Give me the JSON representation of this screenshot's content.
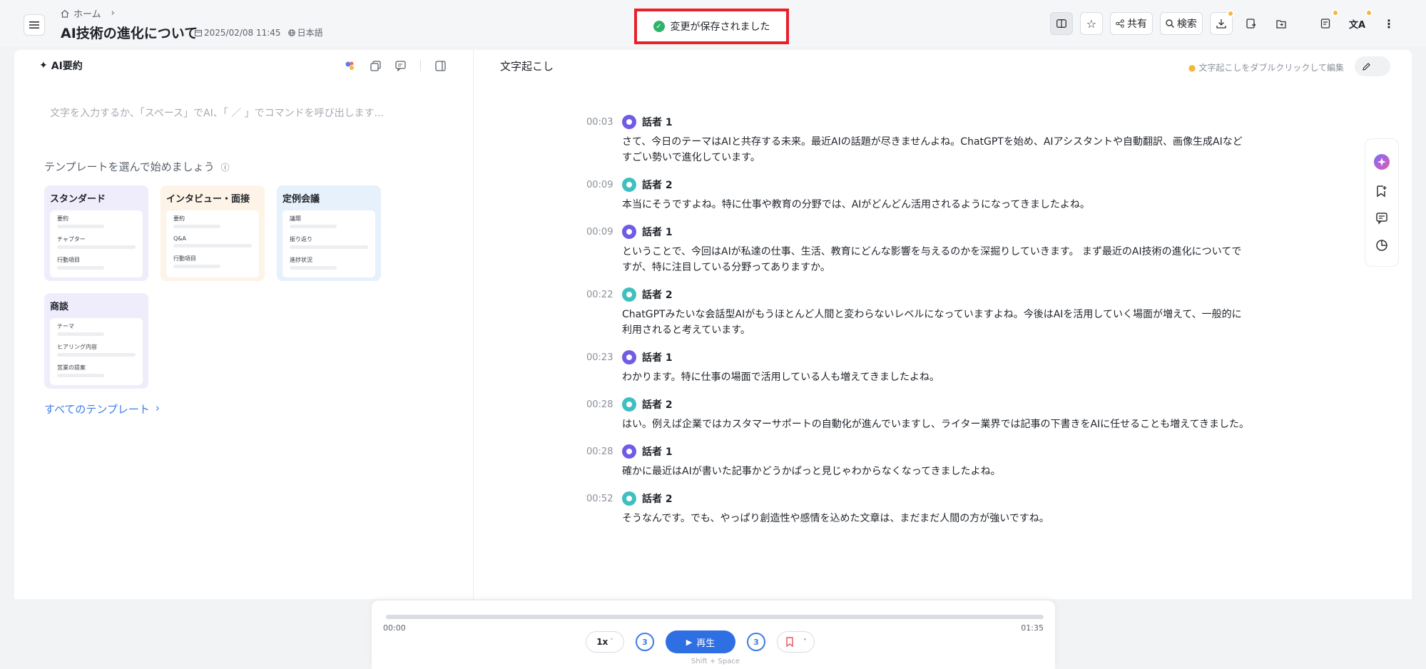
{
  "header": {
    "breadcrumb_home": "ホーム",
    "title": "AI技術の進化について",
    "date": "2025/02/08 11:45",
    "language": "日本語",
    "toast": "変更が保存されました",
    "share_label": "共有",
    "search_label": "検索"
  },
  "summary": {
    "title": "AI要約",
    "input_placeholder": "文字を入力するか、「スペース」でAI、「 ／ 」でコマンドを呼び出します...",
    "template_heading": "テンプレートを選んで始めましょう",
    "templates": [
      {
        "title": "スタンダード",
        "rows": [
          "要約",
          "チャプター",
          "行動項目"
        ],
        "color": "#efedfb"
      },
      {
        "title": "インタビュー・面接",
        "rows": [
          "要約",
          "Q&A",
          "行動項目"
        ],
        "color": "#fdf3e6"
      },
      {
        "title": "定例会議",
        "rows": [
          "議題",
          "振り返り",
          "進捗状況"
        ],
        "color": "#e7f1fb"
      },
      {
        "title": "商談",
        "rows": [
          "テーマ",
          "ヒアリング内容",
          "営業の提案"
        ],
        "color": "#efedfb"
      }
    ],
    "all_templates": "すべてのテンプレート"
  },
  "transcript": {
    "title": "文字起こし",
    "hint": "文字起こしをダブルクリックして編集",
    "segments": [
      {
        "time": "00:03",
        "speaker": "話者 1",
        "sp": "sp1",
        "text": "さて、今日のテーマはAIと共存する未来。最近AIの話題が尽きませんよね。ChatGPTを始め、AIアシスタントや自動翻訳、画像生成AIなどすごい勢いで進化しています。"
      },
      {
        "time": "00:09",
        "speaker": "話者 2",
        "sp": "sp2",
        "text": "本当にそうですよね。特に仕事や教育の分野では、AIがどんどん活用されるようになってきましたよね。"
      },
      {
        "time": "00:09",
        "speaker": "話者 1",
        "sp": "sp1",
        "text": "ということで、今回はAIが私達の仕事、生活、教育にどんな影響を与えるのかを深掘りしていきます。 まず最近のAI技術の進化についてですが、特に注目している分野ってありますか。"
      },
      {
        "time": "00:22",
        "speaker": "話者 2",
        "sp": "sp2",
        "text": "ChatGPTみたいな会話型AIがもうほとんど人間と変わらないレベルになっていますよね。今後はAIを活用していく場面が増えて、一般的に利用されると考えています。"
      },
      {
        "time": "00:23",
        "speaker": "話者 1",
        "sp": "sp1",
        "text": "わかります。特に仕事の場面で活用している人も増えてきましたよね。"
      },
      {
        "time": "00:28",
        "speaker": "話者 2",
        "sp": "sp2",
        "text": "はい。例えば企業ではカスタマーサポートの自動化が進んでいますし、ライター業界では記事の下書きをAIに任せることも増えてきました。"
      },
      {
        "time": "00:28",
        "speaker": "話者 1",
        "sp": "sp1",
        "text": "確かに最近はAIが書いた記事かどうかぱっと見じゃわからなくなってきましたよね。"
      },
      {
        "time": "00:52",
        "speaker": "話者 2",
        "sp": "sp2",
        "text": "そうなんです。でも、やっぱり創造性や感情を込めた文章は、まだまだ人間の方が強いですね。"
      }
    ]
  },
  "player": {
    "current": "00:00",
    "total": "01:35",
    "progress": 0,
    "speed": "1x",
    "skip_back": "3",
    "skip_forward": "3",
    "play_label": "再生",
    "shortcut": "Shift + Space"
  },
  "colors": {
    "accent": "#2f6fe4",
    "toast_border": "#e8202a",
    "badge": "#f5b63c"
  }
}
